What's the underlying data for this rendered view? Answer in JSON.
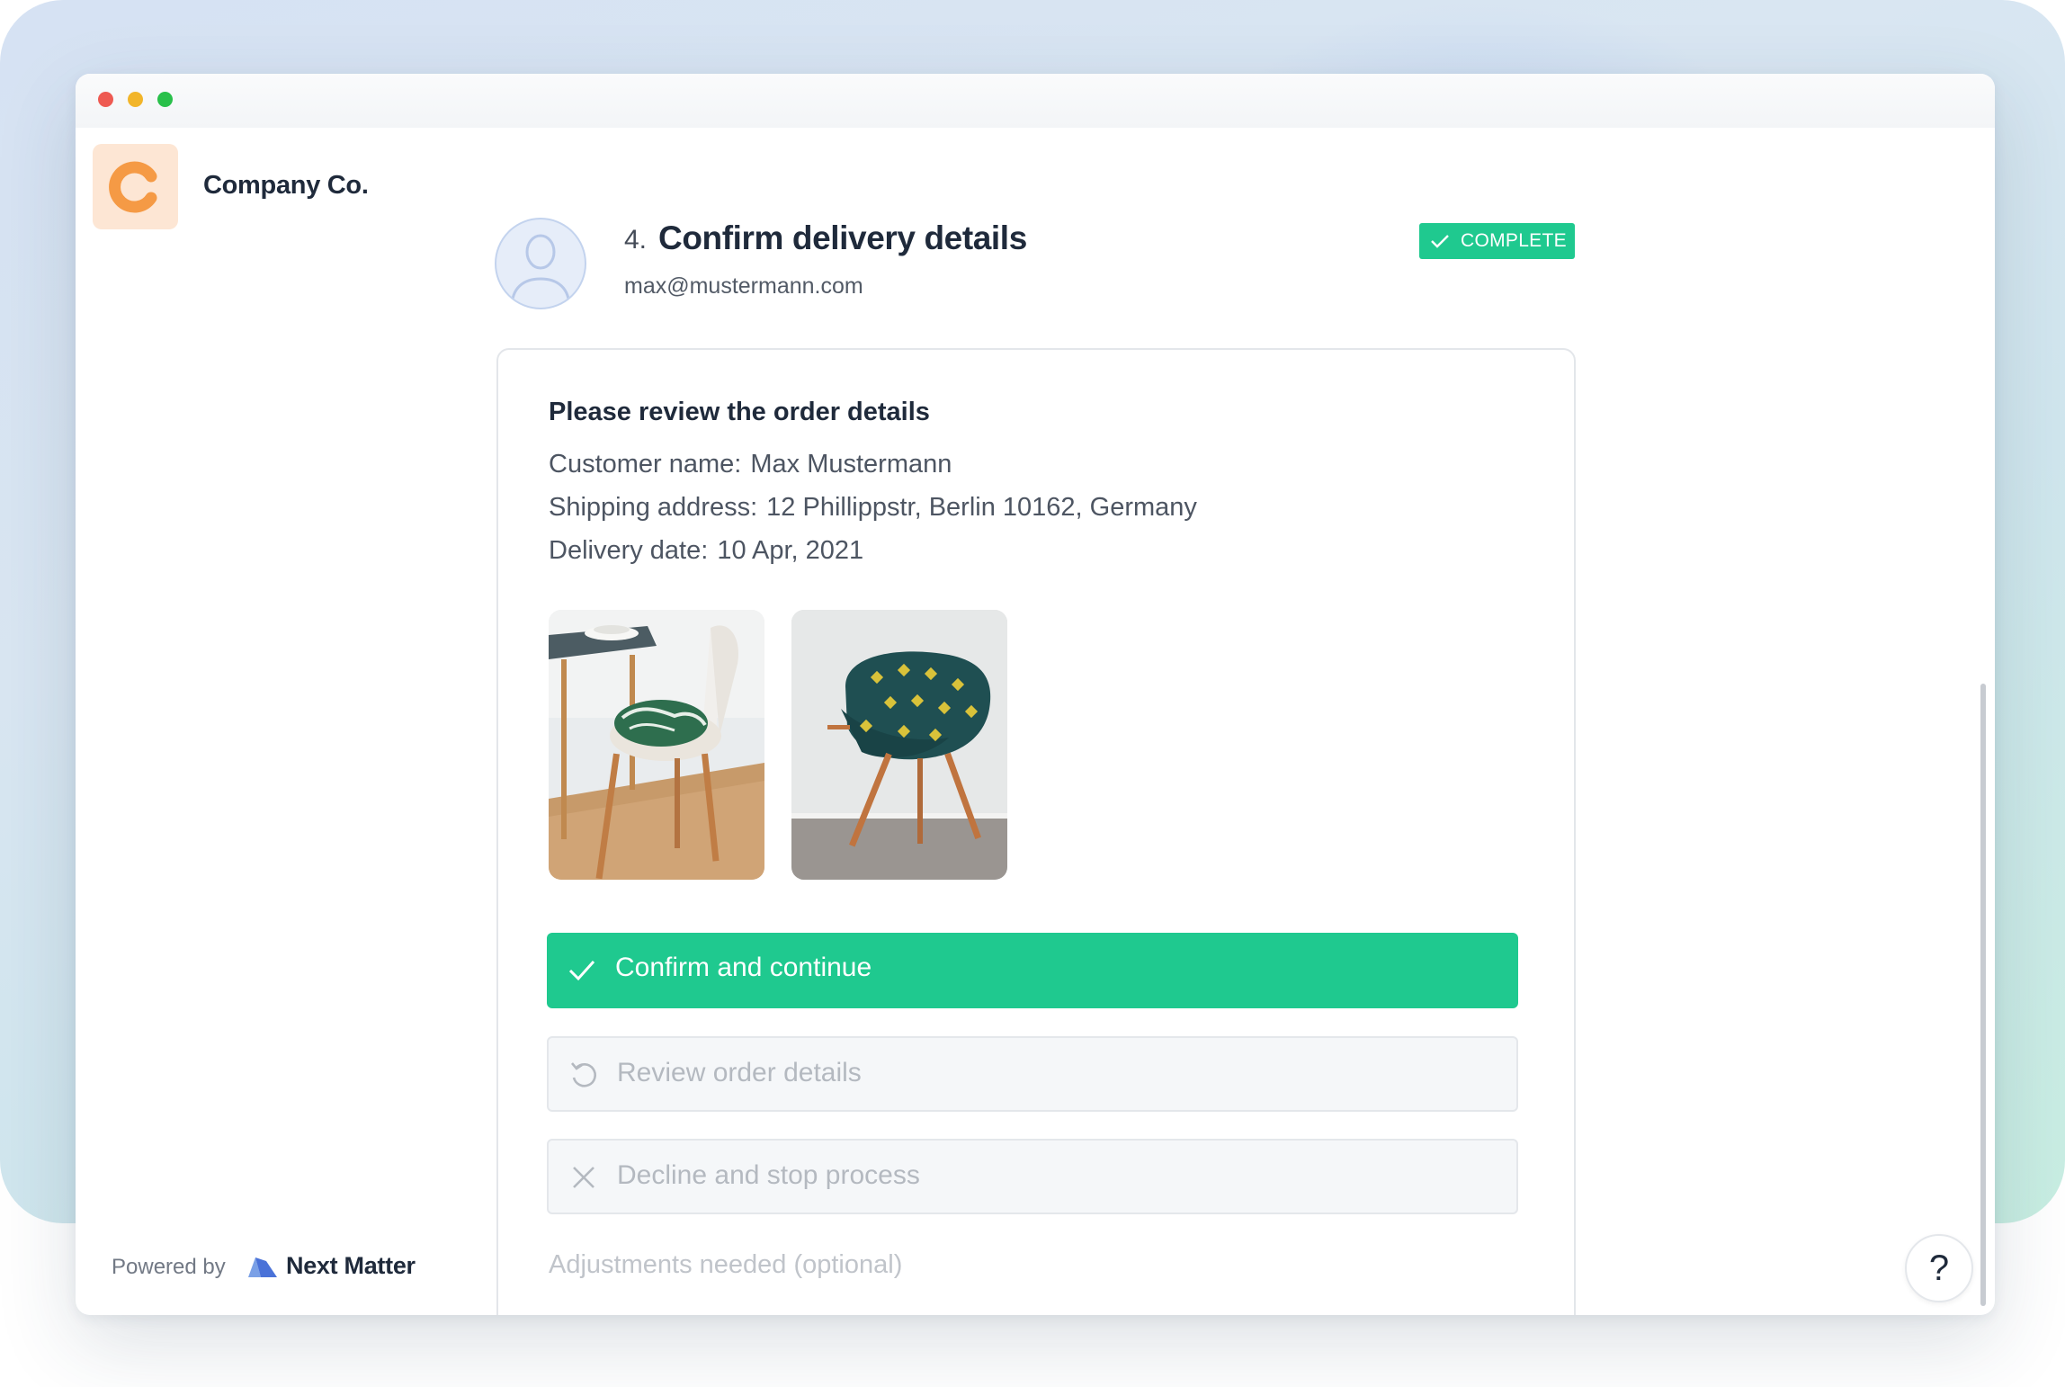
{
  "company": {
    "name": "Company Co."
  },
  "step": {
    "number": "4.",
    "title": "Confirm delivery details",
    "assignee_email": "max@mustermann.com",
    "status": "COMPLETE"
  },
  "review": {
    "heading": "Please review the order details",
    "customer_label": "Customer name:",
    "customer_value": "Max Mustermann",
    "address_label": "Shipping address:",
    "address_value": "12 Phillippstr, Berlin 10162, Germany",
    "date_label": "Delivery date:",
    "date_value": "10 Apr, 2021"
  },
  "actions": {
    "confirm": "Confirm and continue",
    "review": "Review order details",
    "decline": "Decline and stop process"
  },
  "adjustments": {
    "label": "Adjustments needed (optional)"
  },
  "footer": {
    "powered_by": "Powered by",
    "brand": "Next Matter"
  },
  "help": {
    "label": "?"
  },
  "colors": {
    "accent": "#1fc98f",
    "text_dark": "#1f2a3b",
    "logo_bg": "#fde6d4",
    "logo_fg": "#f59a45"
  }
}
